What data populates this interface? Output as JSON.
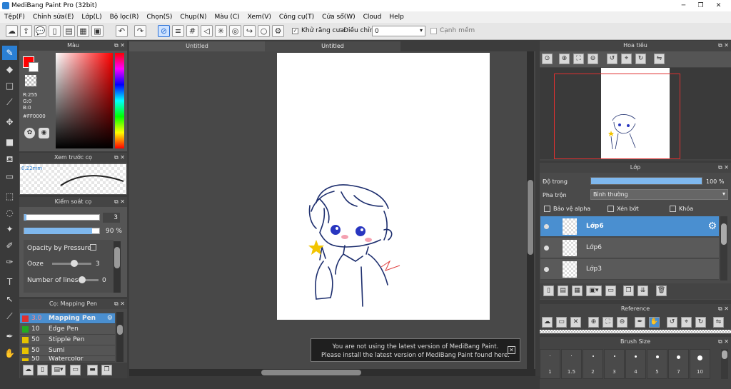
{
  "title": "MediBang Paint Pro (32bit)",
  "window_controls": [
    "─",
    "❐",
    "✕"
  ],
  "menu": [
    "Tệp(F)",
    "Chỉnh sửa(E)",
    "Lớp(L)",
    "Bộ lọc(R)",
    "Chọn(S)",
    "Chụp(N)",
    "Màu (C)",
    "Xem(V)",
    "Công cụ(T)",
    "Cửa sổ(W)",
    "Cloud",
    "Help"
  ],
  "toolbar": {
    "antialias_label": "Khử răng cưa",
    "adjust_label": "Điều chỉnh",
    "adjust_value": "0",
    "soft_edge_label": "Cạnh mềm"
  },
  "color_panel": {
    "title": "Màu",
    "r": "R:255",
    "g": "G:0",
    "b": "B:0",
    "hex": "#FF0000",
    "fg": "#ff0000"
  },
  "brush_preview": {
    "title": "Xem trước cọ",
    "size": "0.22mm"
  },
  "brush_control": {
    "title": "Kiểm soát cọ",
    "size_value": "3",
    "opacity_value": "90 %",
    "opacity_fraction": 0.9,
    "opacity_by_pressure": "Opacity by Pressure",
    "ooze_label": "Ooze",
    "ooze_value": "3",
    "lines_label": "Number of lines",
    "lines_value": "0"
  },
  "brush_list": {
    "title": "Cọ: Mapping Pen",
    "items": [
      {
        "size": "3.0",
        "name": "Mapping Pen",
        "color": "#e03030"
      },
      {
        "size": "10",
        "name": "Edge Pen",
        "color": "#22aa22"
      },
      {
        "size": "50",
        "name": "Stipple Pen",
        "color": "#e6c200"
      },
      {
        "size": "50",
        "name": "Sumi",
        "color": "#e6c200"
      },
      {
        "size": "50",
        "name": "Watercolor",
        "color": "#e6c200"
      }
    ]
  },
  "doc_tabs": [
    "Untitled",
    "Untitled"
  ],
  "notice": {
    "line1": "You are not using the latest version of MediBang Paint.",
    "line2": "Please install the latest version of MediBang Paint found here."
  },
  "navigator": {
    "title": "Hoa tiêu"
  },
  "layers": {
    "title": "Lớp",
    "opacity_label": "Độ trong",
    "opacity_value": "100 %",
    "opacity_fraction": 1.0,
    "blend_label": "Pha trộn",
    "blend_value": "Bình thường",
    "protect_alpha": "Bảo vệ alpha",
    "clip": "Xén bớt",
    "lock": "Khóa",
    "items": [
      "Lớp6",
      "Lớp6",
      "Lớp3"
    ]
  },
  "reference": {
    "title": "Reference"
  },
  "brush_size": {
    "title": "Brush Size",
    "sizes": [
      "1",
      "1.5",
      "2",
      "3",
      "4",
      "5",
      "7",
      "10"
    ]
  }
}
